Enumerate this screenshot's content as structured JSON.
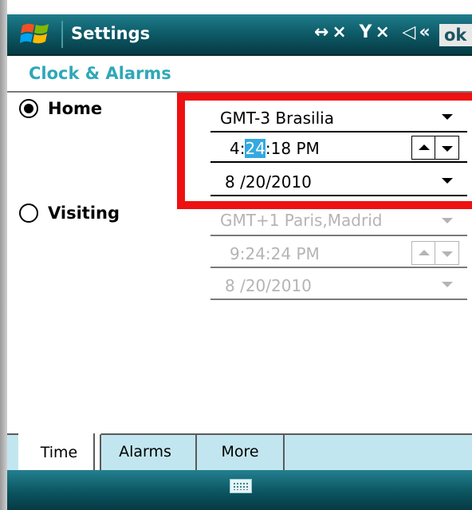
{
  "titlebar": {
    "title": "Settings",
    "status_icons": "↔× Y× ◁«",
    "ok_label": "ok"
  },
  "header": {
    "title": "Clock & Alarms"
  },
  "home": {
    "label": "Home",
    "selected": true,
    "timezone": "GMT-3 Brasilia",
    "time_hour": "4:",
    "time_minute": "24",
    "time_rest": ":18 PM",
    "date": "8 /20/2010"
  },
  "visiting": {
    "label": "Visiting",
    "selected": false,
    "timezone": "GMT+1 Paris,Madrid",
    "time": "9:24:24 PM",
    "date": "8 /20/2010"
  },
  "tabs": [
    {
      "label": "Time",
      "active": true
    },
    {
      "label": "Alarms",
      "active": false
    },
    {
      "label": "More",
      "active": false
    }
  ],
  "bottombar": {
    "icon": "keyboard-icon"
  },
  "colors": {
    "titlebar": "#0d5966",
    "header_text": "#2fa8b8",
    "highlight_box": "#ee1111",
    "selection": "#35a9e0",
    "tab_strip": "#c2e6ef"
  }
}
